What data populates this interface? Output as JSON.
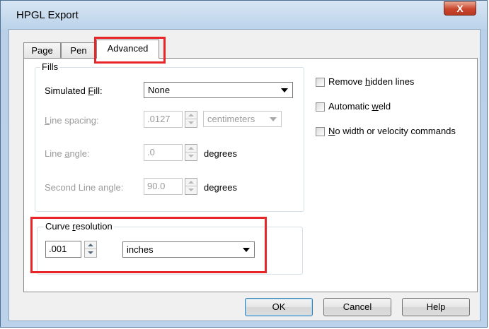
{
  "window": {
    "title": "HPGL Export",
    "close_label": "X"
  },
  "tabs": [
    {
      "label": "Page"
    },
    {
      "label": "Pen"
    },
    {
      "label": "Advanced"
    }
  ],
  "fills": {
    "group_label": "Fills",
    "simulated_fill": {
      "label_pre": "Simulated ",
      "label_key": "F",
      "label_post": "ill:",
      "value": "None"
    },
    "line_spacing": {
      "label_key": "L",
      "label_post": "ine spacing:",
      "value": ".0127",
      "unit": "centimeters"
    },
    "line_angle": {
      "label_pre": "Line ",
      "label_key": "a",
      "label_post": "ngle:",
      "value": ".0",
      "unit": "degrees"
    },
    "second_line_angle": {
      "label": "Second Line angle:",
      "value": "90.0",
      "unit": "degrees"
    }
  },
  "options": {
    "remove_hidden": {
      "pre": "Remove ",
      "key": "h",
      "post": "idden lines"
    },
    "automatic_weld": {
      "pre": "Automatic ",
      "key": "w",
      "post": "eld"
    },
    "no_width": {
      "key": "N",
      "post": "o width or velocity commands"
    }
  },
  "curve": {
    "label_pre": "Curve ",
    "label_key": "r",
    "label_post": "esolution",
    "value": ".001",
    "unit": "inches"
  },
  "buttons": {
    "ok": "OK",
    "cancel": "Cancel",
    "help": "Help"
  },
  "colors": {
    "highlight": "#e8262a",
    "title_bg": "#c9dcee"
  }
}
